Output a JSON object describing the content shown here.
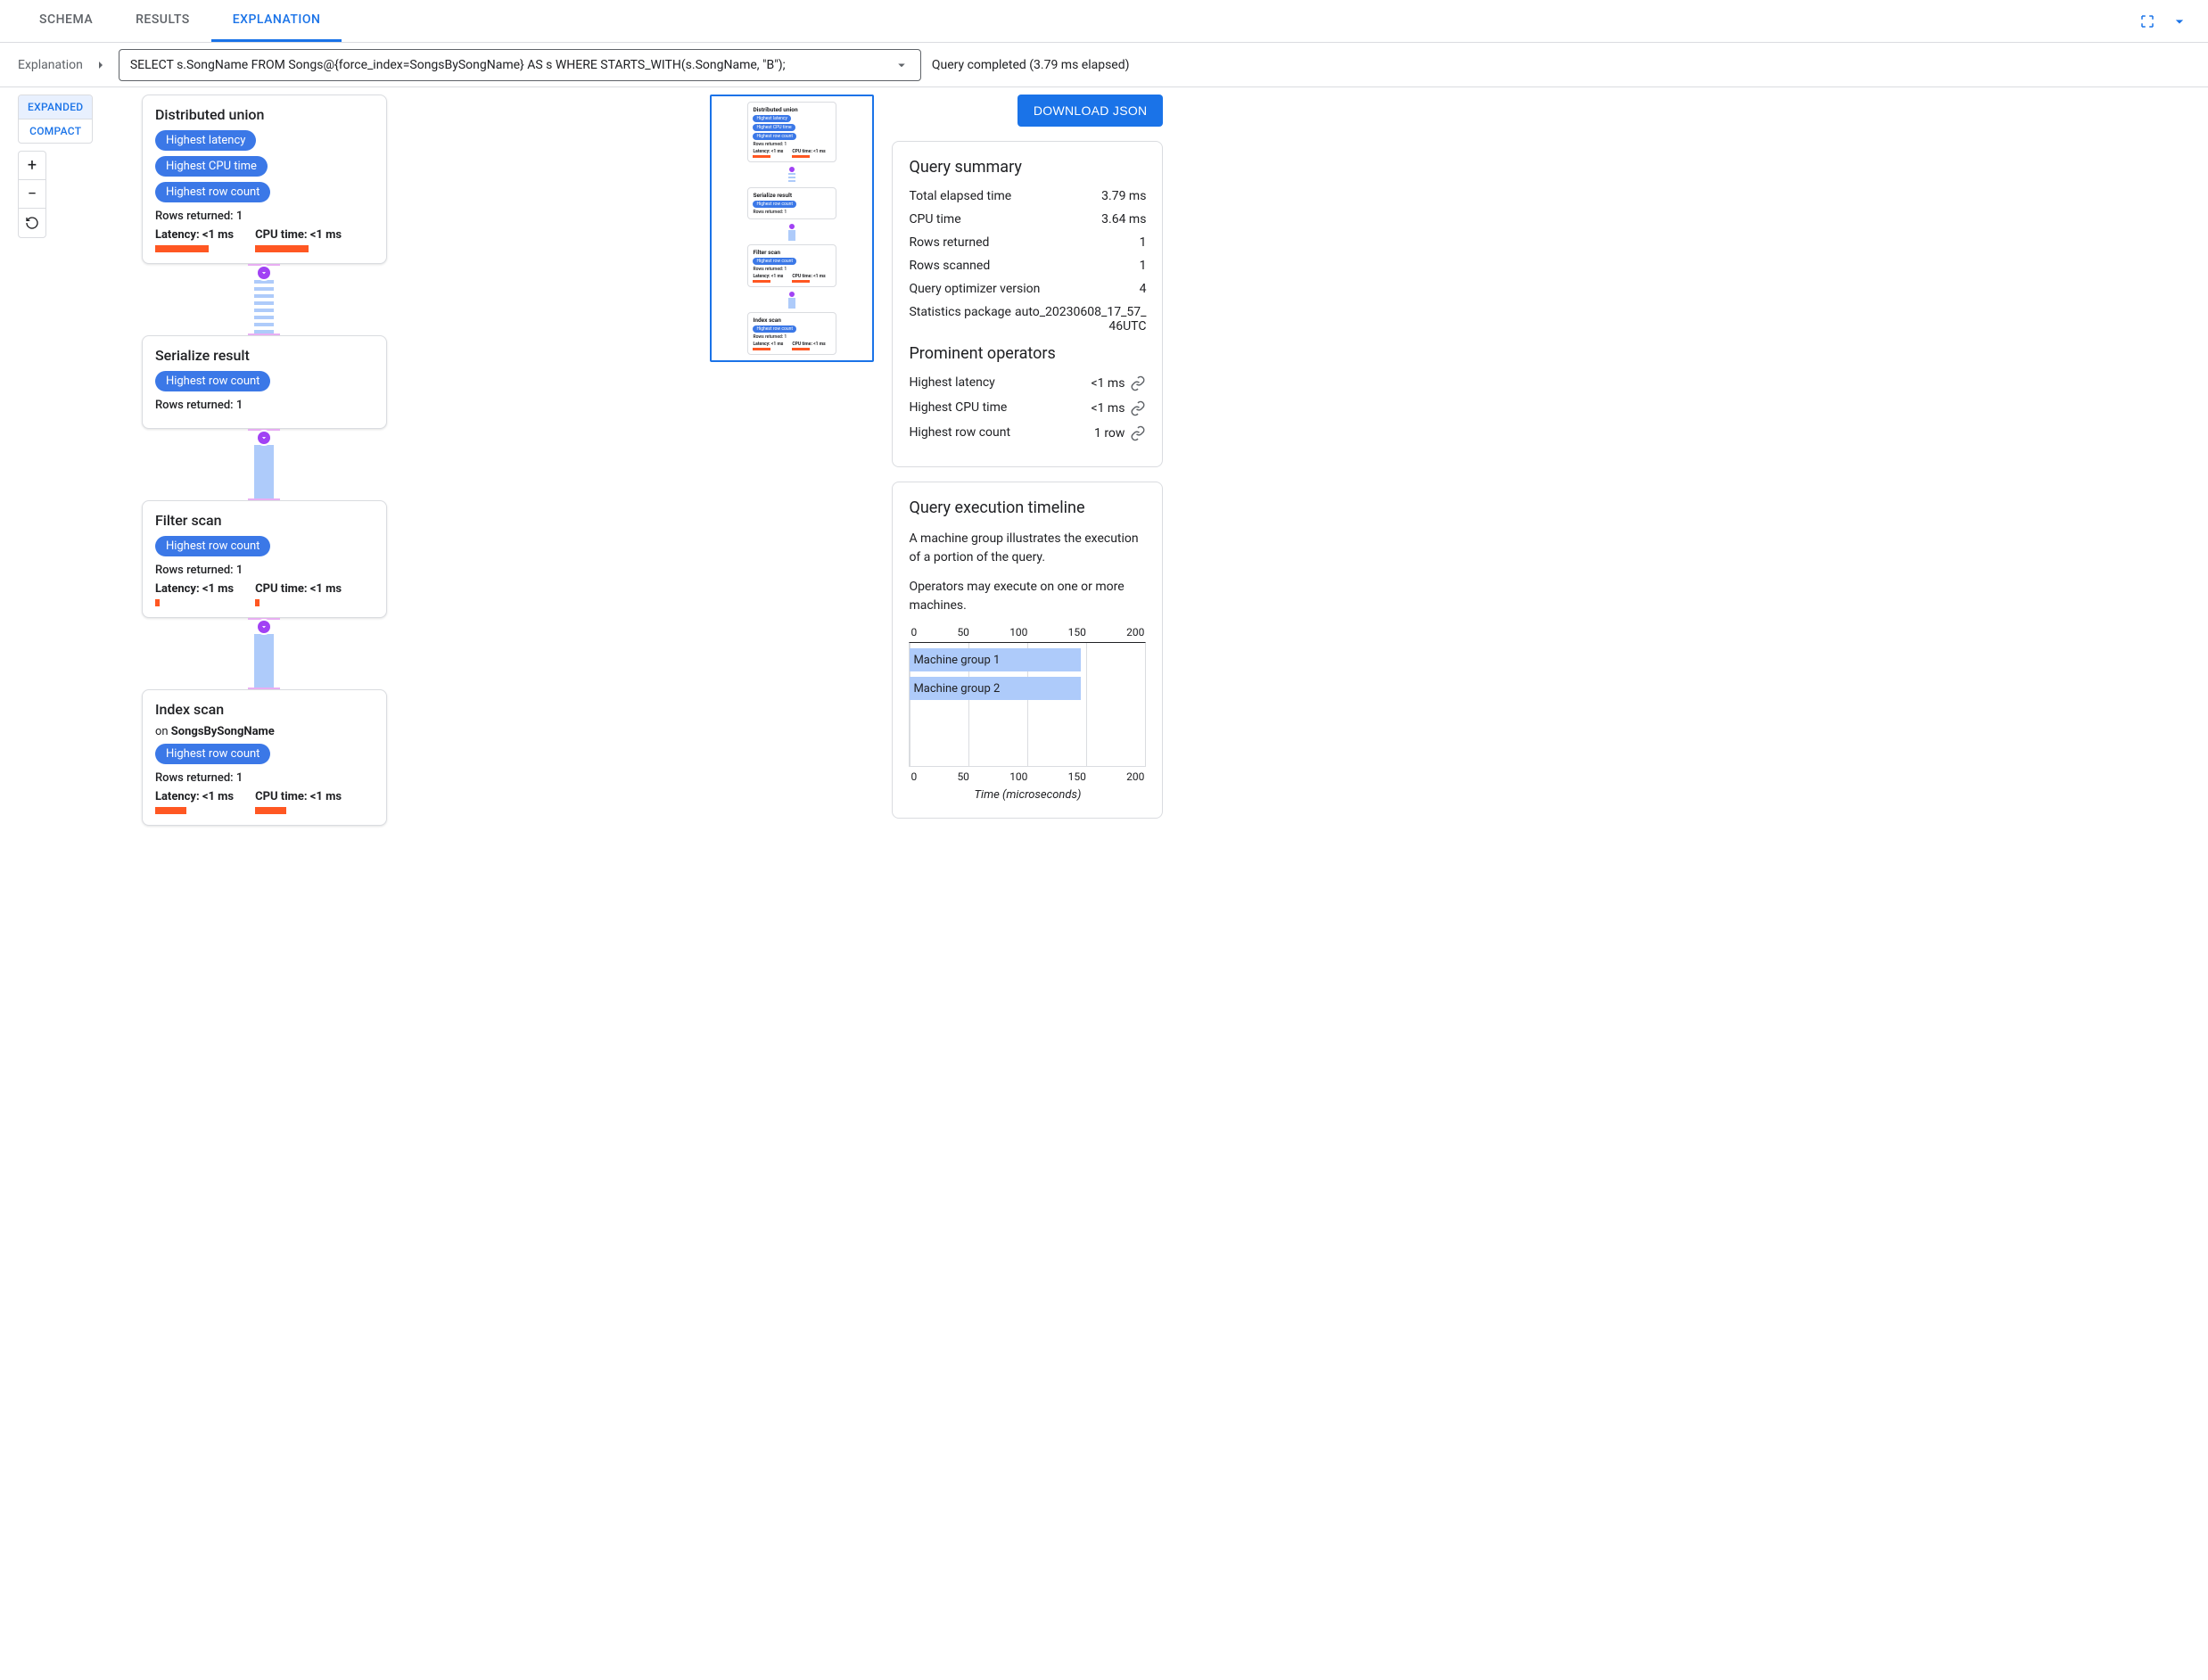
{
  "tabs": {
    "schema": "SCHEMA",
    "results": "RESULTS",
    "explanation": "EXPLANATION"
  },
  "breadcrumb_label": "Explanation",
  "query": "SELECT s.SongName FROM Songs@{force_index=SongsBySongName} AS s WHERE STARTS_WITH(s.SongName, \"B\");",
  "status": "Query completed (3.79 ms elapsed)",
  "view": {
    "expanded": "EXPANDED",
    "compact": "COMPACT"
  },
  "download": "DOWNLOAD JSON",
  "nodes": [
    {
      "title": "Distributed union",
      "chips": [
        "Highest latency",
        "Highest CPU time",
        "Highest row count"
      ],
      "rows": "Rows returned: 1",
      "lat": "Latency: <1 ms",
      "cpu": "CPU time: <1 ms",
      "lat_bar": "w60",
      "cpu_bar": "w60",
      "edge": "striped"
    },
    {
      "title": "Serialize result",
      "chips": [
        "Highest row count"
      ],
      "rows": "Rows returned: 1",
      "edge": "solid"
    },
    {
      "title": "Filter scan",
      "chips": [
        "Highest row count"
      ],
      "rows": "Rows returned: 1",
      "lat": "Latency: <1 ms",
      "cpu": "CPU time: <1 ms",
      "lat_bar": "w5",
      "cpu_bar": "w5",
      "edge": "solid"
    },
    {
      "title": "Index scan",
      "sub_prefix": "on ",
      "sub_index": "SongsBySongName",
      "chips": [
        "Highest row count"
      ],
      "rows": "Rows returned: 1",
      "lat": "Latency: <1 ms",
      "cpu": "CPU time: <1 ms",
      "lat_bar": "w35",
      "cpu_bar": "w35"
    }
  ],
  "summary": {
    "heading": "Query summary",
    "rows": [
      {
        "k": "Total elapsed time",
        "v": "3.79 ms"
      },
      {
        "k": "CPU time",
        "v": "3.64 ms"
      },
      {
        "k": "Rows returned",
        "v": "1"
      },
      {
        "k": "Rows scanned",
        "v": "1"
      },
      {
        "k": "Query optimizer version",
        "v": "4"
      },
      {
        "k": "Statistics package",
        "v": "auto_20230608_17_57_46UTC"
      }
    ]
  },
  "prominent": {
    "heading": "Prominent operators",
    "rows": [
      {
        "k": "Highest latency",
        "v": "<1 ms"
      },
      {
        "k": "Highest CPU time",
        "v": "<1 ms"
      },
      {
        "k": "Highest row count",
        "v": "1 row"
      }
    ]
  },
  "timeline": {
    "heading": "Query execution timeline",
    "desc1": "A machine group illustrates the execution of a portion of the query.",
    "desc2": "Operators may execute on one or more machines.",
    "xlabel": "Time (microseconds)",
    "ticks": [
      "0",
      "50",
      "100",
      "150",
      "200"
    ]
  },
  "chart_data": {
    "type": "bar",
    "title": "Query execution timeline",
    "xlabel": "Time (microseconds)",
    "ylabel": "",
    "xlim": [
      0,
      200
    ],
    "categories": [
      "Machine group 1",
      "Machine group 2"
    ],
    "values": [
      145,
      145
    ]
  }
}
